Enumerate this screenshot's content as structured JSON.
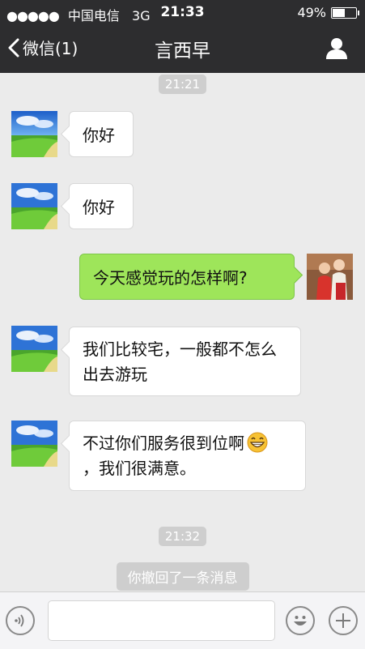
{
  "status_bar": {
    "signal_dots": "●●●●●",
    "carrier": "中国电信",
    "network": "3G",
    "time": "21:33",
    "battery": "49%",
    "battery_level": 0.49
  },
  "nav": {
    "back_label": "微信(1)",
    "title": "言西早",
    "profile_icon": "person-icon"
  },
  "messages": [
    {
      "type": "timestamp",
      "text": "21:21"
    },
    {
      "type": "incoming",
      "text": "你好"
    },
    {
      "type": "incoming",
      "text": "你好"
    },
    {
      "type": "outgoing",
      "text": "今天感觉玩的怎样啊?"
    },
    {
      "type": "incoming",
      "text": "我们比较宅，一般都不怎么出去游玩"
    },
    {
      "type": "incoming",
      "text": "不过你们服务很到位啊",
      "text2": "，我们很满意。",
      "emoji": "grin-emoji"
    },
    {
      "type": "timestamp",
      "text": "21:32"
    }
  ],
  "recall_notice": "你撤回了一条消息",
  "input_bar": {
    "voice_icon": "voice-icon",
    "emoji_icon": "smiley-icon",
    "add_icon": "plus-icon",
    "value": "",
    "placeholder": ""
  },
  "colors": {
    "header_bg": "#2d2d2f",
    "chat_bg": "#ebebeb",
    "outgoing_bubble": "#9ee55a",
    "incoming_bubble": "#ffffff"
  }
}
